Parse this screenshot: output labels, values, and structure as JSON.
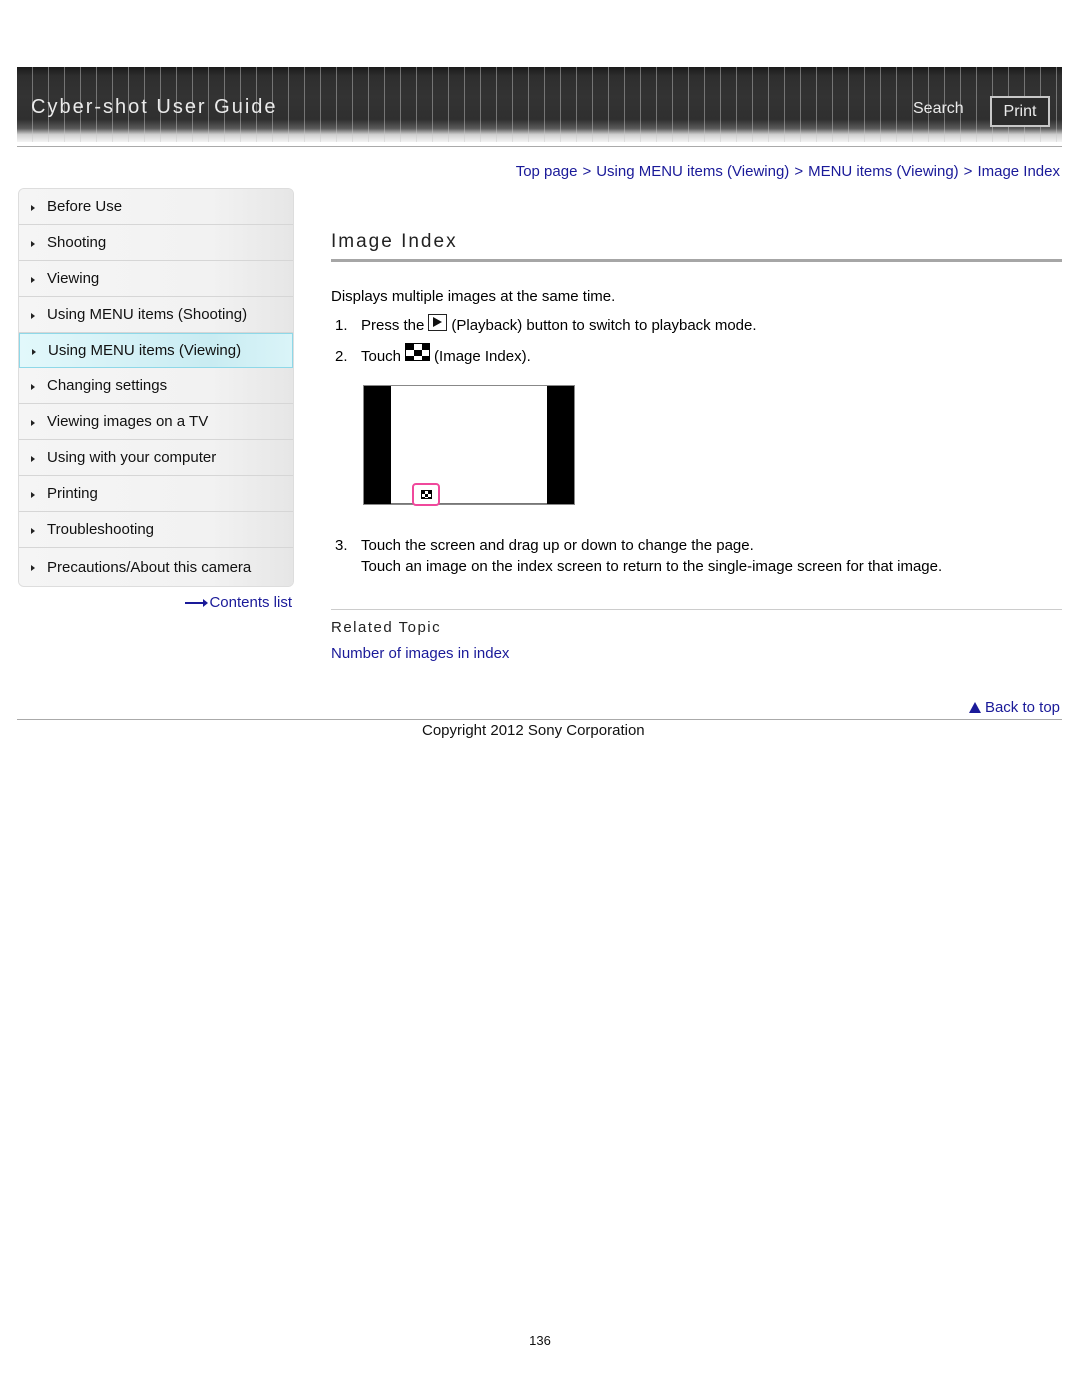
{
  "header": {
    "title": "Cyber-shot User Guide",
    "search_label": "Search",
    "print_label": "Print"
  },
  "breadcrumb": [
    {
      "label": "Top page"
    },
    {
      "label": "Using MENU items (Viewing)"
    },
    {
      "label": "MENU items (Viewing)"
    },
    {
      "label": "Image Index"
    }
  ],
  "breadcrumb_separator": ">",
  "sidebar": {
    "items": [
      {
        "label": "Before Use",
        "active": false
      },
      {
        "label": "Shooting",
        "active": false
      },
      {
        "label": "Viewing",
        "active": false
      },
      {
        "label": "Using MENU items (Shooting)",
        "active": false
      },
      {
        "label": "Using MENU items (Viewing)",
        "active": true
      },
      {
        "label": "Changing settings",
        "active": false
      },
      {
        "label": "Viewing images on a TV",
        "active": false
      },
      {
        "label": "Using with your computer",
        "active": false
      },
      {
        "label": "Printing",
        "active": false
      },
      {
        "label": "Troubleshooting",
        "active": false
      },
      {
        "label": "Precautions/About this camera",
        "active": false
      }
    ],
    "contents_link": "Contents list"
  },
  "main": {
    "title": "Image Index",
    "intro": "Displays multiple images at the same time.",
    "steps": [
      {
        "num": "1.",
        "before": "Press the",
        "icon": "playback-icon",
        "after": "(Playback) button to switch to playback mode."
      },
      {
        "num": "2.",
        "before": "Touch",
        "icon": "image-index-icon",
        "after": "(Image Index)."
      },
      {
        "num": "3.",
        "text": "Touch the screen and drag up or down to change the page.",
        "sub": "Touch an image on the index screen to return to the single-image screen for that image."
      }
    ],
    "related_title": "Related Topic",
    "related_links": [
      "Number of images in index"
    ],
    "highlight_color": "#f0489c"
  },
  "footer": {
    "back_to_top": "Back to top",
    "copyright": "Copyright 2012 Sony Corporation",
    "page_number": "136"
  },
  "colors": {
    "link": "#1a1a99",
    "active_nav": "#c9ecf2"
  }
}
